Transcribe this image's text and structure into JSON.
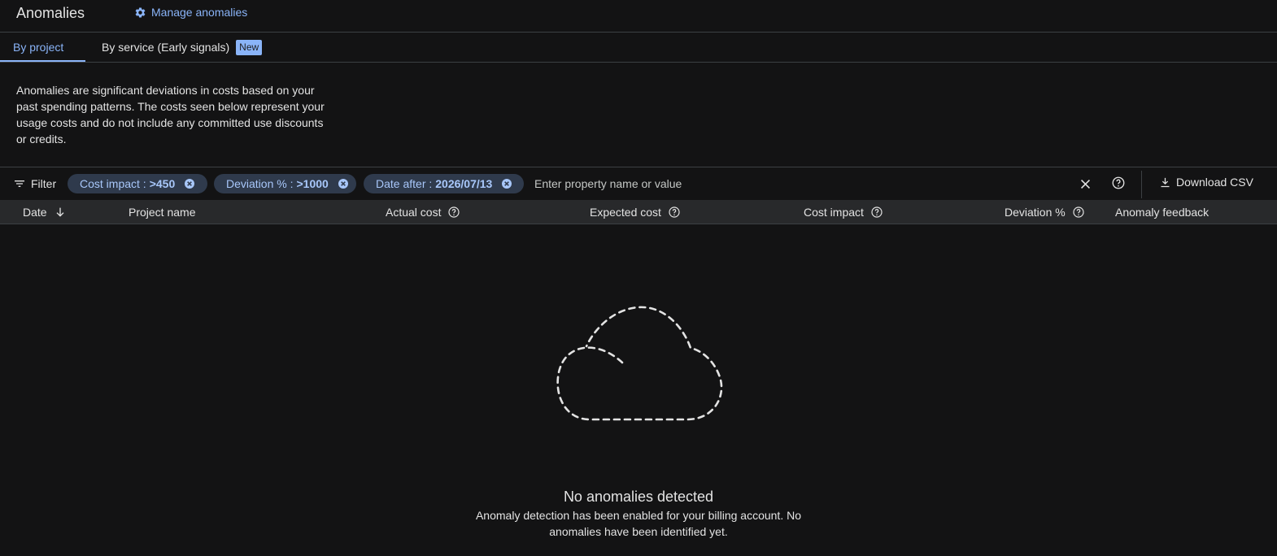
{
  "header": {
    "title": "Anomalies",
    "manage_label": "Manage anomalies"
  },
  "tabs": [
    {
      "label": "By project",
      "active": true
    },
    {
      "label": "By service (Early signals)",
      "badge": "New",
      "active": false
    }
  ],
  "description": "Anomalies are significant deviations in costs based on your past spending patterns. The costs seen below represent your usage costs and do not include any committed use discounts or credits.",
  "filter": {
    "label": "Filter",
    "chips": [
      {
        "key": "Cost impact :",
        "value": ">450"
      },
      {
        "key": "Deviation % :",
        "value": ">1000"
      },
      {
        "key": "Date after :",
        "value": "2026/07/13"
      }
    ],
    "placeholder": "Enter property name or value",
    "download_label": "Download CSV"
  },
  "table": {
    "columns": [
      {
        "label": "Date",
        "sorted": "descending"
      },
      {
        "label": "Project name"
      },
      {
        "label": "Actual cost",
        "help": true
      },
      {
        "label": "Expected cost",
        "help": true
      },
      {
        "label": "Cost impact",
        "help": true
      },
      {
        "label": "Deviation %",
        "help": true
      },
      {
        "label": "Anomaly feedback"
      }
    ],
    "rows": []
  },
  "empty_state": {
    "icon": "cloud-dashed-icon",
    "title": "No anomalies detected",
    "text": "Anomaly detection has been enabled for your billing account. No anomalies have been identified yet."
  },
  "colors": {
    "background": "#131314",
    "accent": "#8ab4f8",
    "chip_bg": "#2f3a4c",
    "header_row_bg": "#28292b"
  }
}
